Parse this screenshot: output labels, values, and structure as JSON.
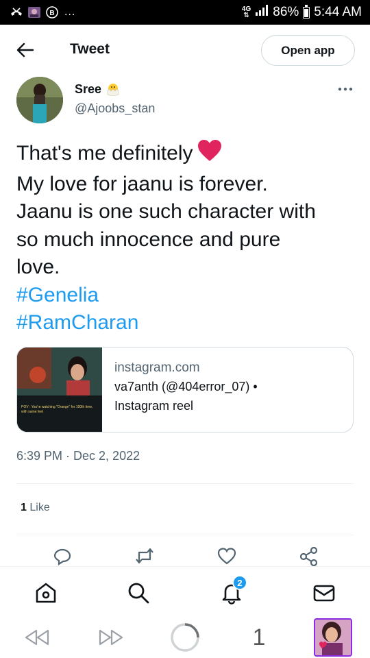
{
  "status_bar": {
    "network": "4G",
    "battery": "86%",
    "time": "5:44 AM",
    "more": "..."
  },
  "header": {
    "title": "Tweet",
    "open_app_label": "Open app"
  },
  "author": {
    "name": "Sree",
    "handle": "@Ajoobs_stan"
  },
  "tweet": {
    "lines": [
      "That's me definitely",
      "My love for jaanu is forever.",
      "Jaanu is one such character with",
      "so much innocence and pure",
      "love."
    ],
    "hashtags": [
      "#Genelia",
      "#RamCharan"
    ],
    "timestamp": "6:39 PM · Dec 2, 2022",
    "likes_count": "1",
    "likes_label": "Like"
  },
  "card": {
    "domain": "instagram.com",
    "title": "va7anth (@404error_07) •",
    "subtitle": "Instagram reel",
    "thumb_caption": "POV : You're watching \"Orange\" for 100th time, with same feel"
  },
  "bottom_nav": {
    "notifications_badge": "2"
  },
  "browser_bar": {
    "tab_count": "1"
  },
  "colors": {
    "accent": "#1d9bf0",
    "text": "#0f1419",
    "secondary": "#536471",
    "border": "#cfd9de",
    "heart": "#e0245e"
  }
}
